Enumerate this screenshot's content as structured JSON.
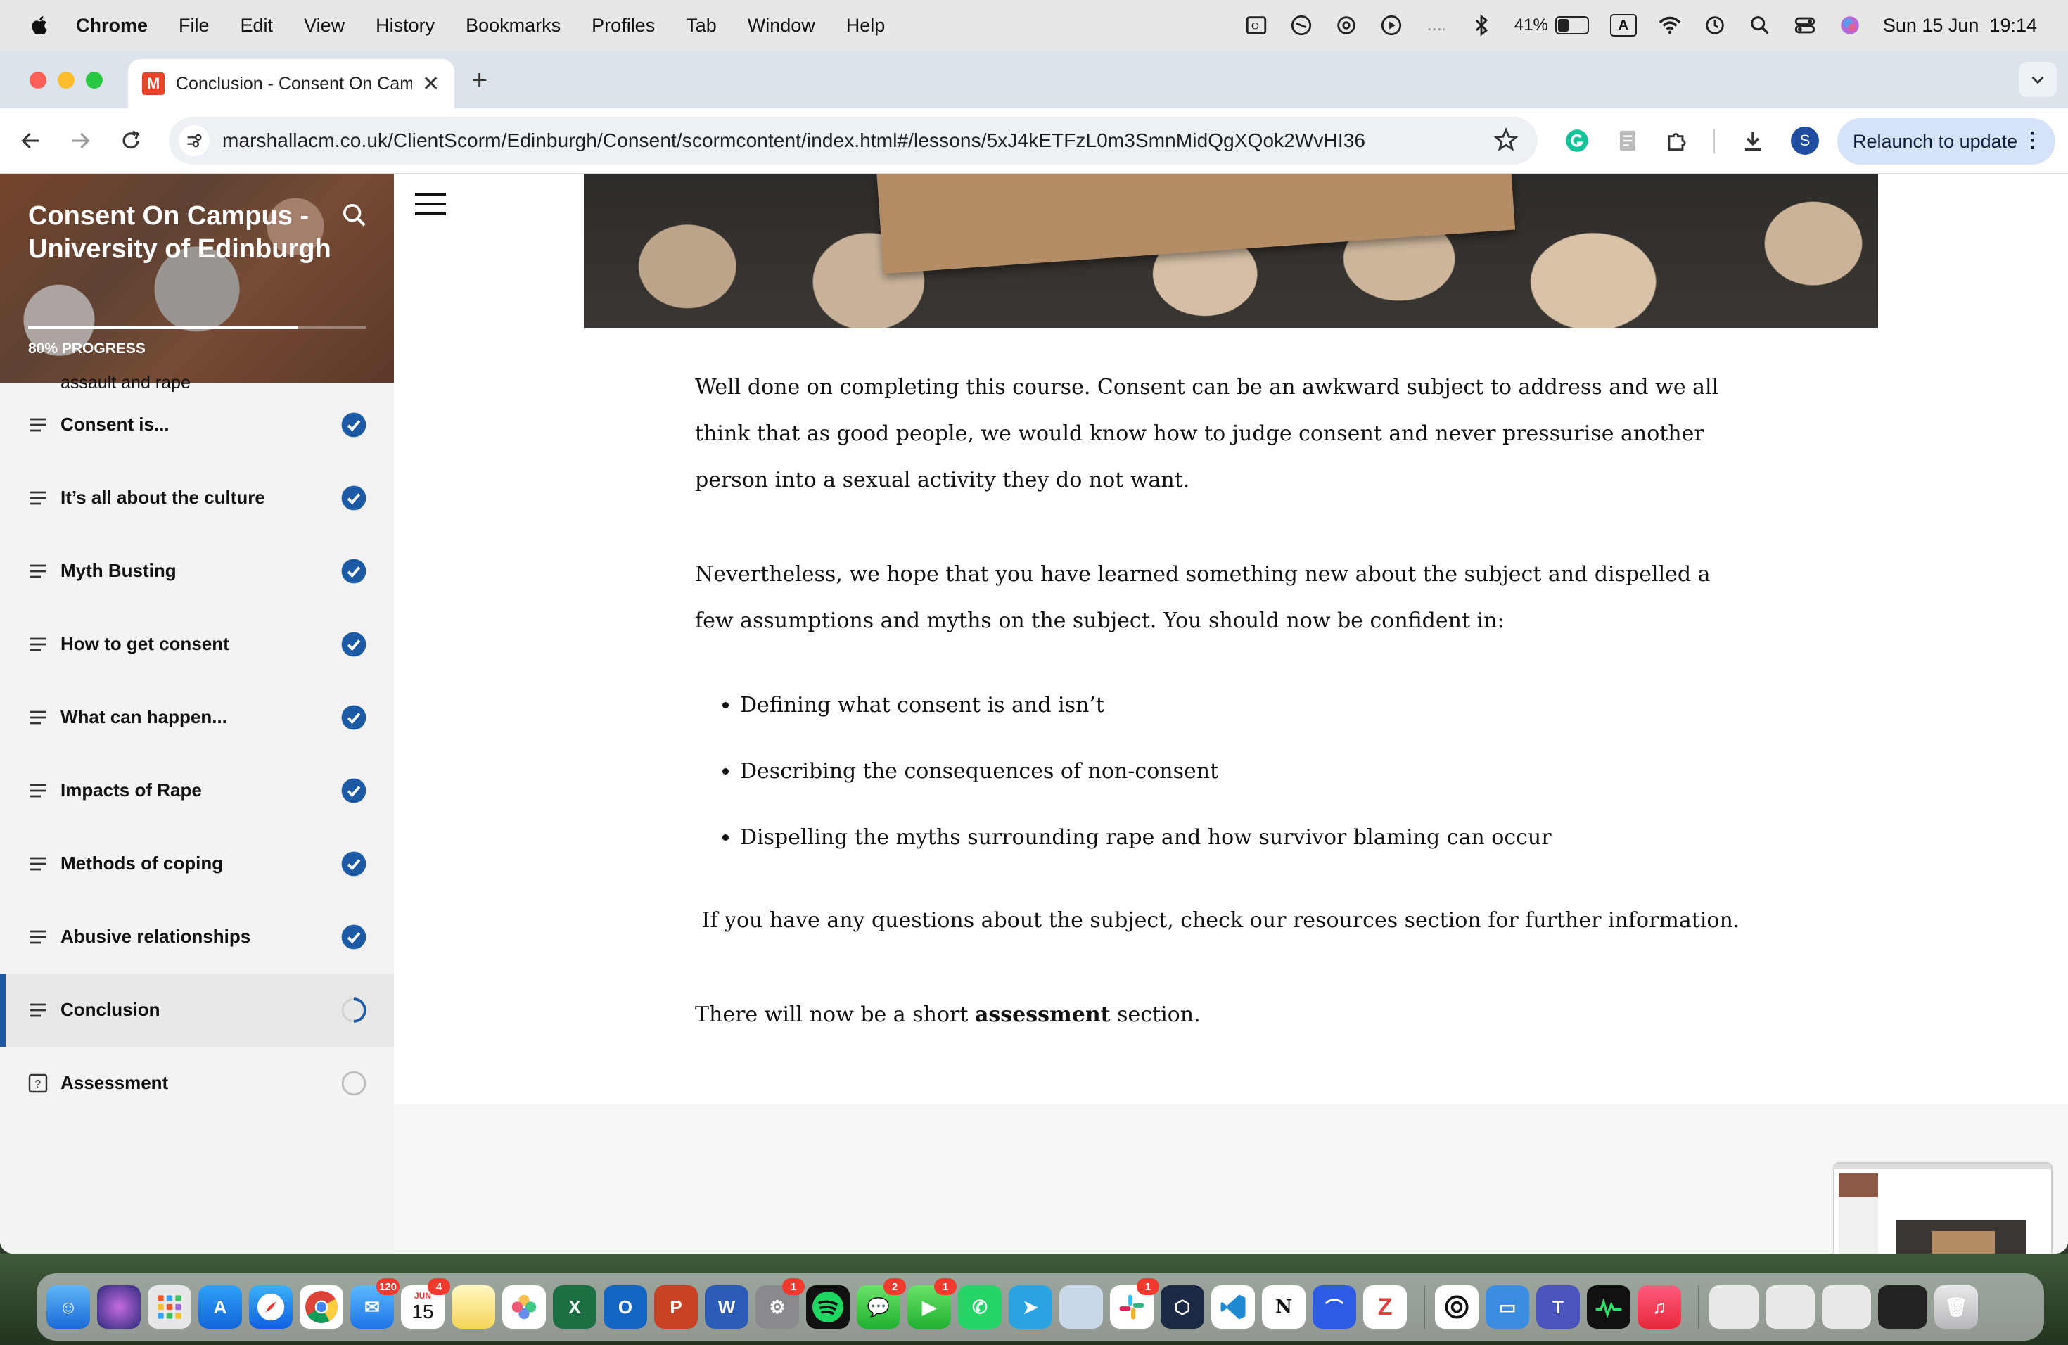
{
  "menubar": {
    "app_name": "Chrome",
    "items": [
      "File",
      "Edit",
      "View",
      "History",
      "Bookmarks",
      "Profiles",
      "Tab",
      "Window",
      "Help"
    ],
    "battery_percent": "41%",
    "battery_level": 0.41,
    "input_source": "A",
    "datetime": "Sun 15 Jun  19:14"
  },
  "browser": {
    "tab_title": "Conclusion - Consent On Campus",
    "favicon_letter": "M",
    "url": "marshallacm.co.uk/ClientScorm/Edinburgh/Consent/scormcontent/index.html#/lessons/5xJ4kETFzL0m3SmnMidQgXQok2WvHI36",
    "profile_initial": "S",
    "relaunch_label": "Relaunch to update"
  },
  "course": {
    "title": "Consent On Campus - University of Edinburgh",
    "progress_label": "80% PROGRESS",
    "progress_value": 0.8,
    "partial_item": "assault and rape",
    "lessons": [
      {
        "label": "Consent is...",
        "status": "complete"
      },
      {
        "label": "It’s all about the culture",
        "status": "complete"
      },
      {
        "label": "Myth Busting",
        "status": "complete"
      },
      {
        "label": "How to get consent",
        "status": "complete"
      },
      {
        "label": "What can happen...",
        "status": "complete"
      },
      {
        "label": "Impacts of Rape",
        "status": "complete"
      },
      {
        "label": "Methods of coping",
        "status": "complete"
      },
      {
        "label": "Abusive relationships",
        "status": "complete"
      },
      {
        "label": "Conclusion",
        "status": "in-progress"
      },
      {
        "label": "Assessment",
        "status": "not-started"
      }
    ]
  },
  "article": {
    "p1": "Well done on completing this course. Consent can be an awkward subject to address and we all think that as good people, we would know how to judge consent and never pressurise another person into a sexual activity they do not want.",
    "p2": "Nevertheless, we hope that you have learned something new about the subject and dispelled a few assumptions and myths on the subject.   You should now be confident in:",
    "bullets": [
      "Defining what consent is and isn’t",
      "Describing the consequences of non-consent",
      "Dispelling the myths surrounding rape and how survivor blaming can occur"
    ],
    "p3": " If you have any questions about the subject, check our resources section for further information.",
    "p4_before": "There will now be a short ",
    "p4_bold": "assessment",
    "p4_after": " section."
  },
  "dock": {
    "badges": {
      "mail": "120",
      "calendar": "4",
      "calendar_day": "15",
      "calendar_month": "JUN",
      "settings": "1",
      "messages": "2",
      "facetime": "1",
      "slack": "1"
    }
  },
  "colors": {
    "accent": "#1c5aa6",
    "complete": "#1c5aa6",
    "menubar": "#e9e6e6",
    "tabstrip": "#dde3ea"
  }
}
